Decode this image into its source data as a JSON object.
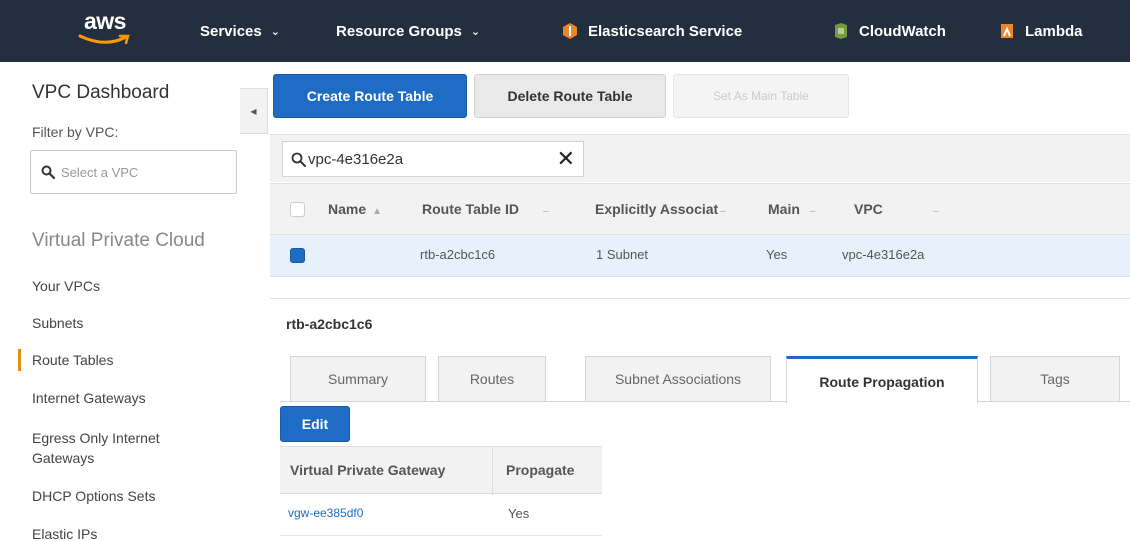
{
  "topnav": {
    "logo_text": "aws",
    "services": "Services",
    "resource_groups": "Resource Groups",
    "shortcuts": [
      {
        "label": "Elasticsearch Service",
        "icon": "elasticsearch-icon",
        "color": "#e7862b"
      },
      {
        "label": "CloudWatch",
        "icon": "cloudwatch-icon",
        "color": "#759c3e"
      },
      {
        "label": "Lambda",
        "icon": "lambda-icon",
        "color": "#e7862b"
      }
    ]
  },
  "sidebar": {
    "title": "VPC Dashboard",
    "filter_label": "Filter by VPC:",
    "vpc_select_placeholder": "Select a VPC",
    "section": "Virtual Private Cloud",
    "items": [
      {
        "label": "Your VPCs"
      },
      {
        "label": "Subnets"
      },
      {
        "label": "Route Tables",
        "active": true
      },
      {
        "label": "Internet Gateways"
      },
      {
        "label": "Egress Only Internet Gateways"
      },
      {
        "label": "DHCP Options Sets"
      },
      {
        "label": "Elastic IPs"
      }
    ]
  },
  "toolbar": {
    "create": "Create Route Table",
    "delete": "Delete Route Table",
    "set_main": "Set As Main Table"
  },
  "search": {
    "value": "vpc-4e316e2a",
    "clear": "✕"
  },
  "table": {
    "columns": [
      "Name",
      "Route Table ID",
      "Explicitly Associat",
      "Main",
      "VPC"
    ],
    "rows": [
      {
        "name": "",
        "route_table_id": "rtb-a2cbc1c6",
        "explicitly_associated": "1 Subnet",
        "main": "Yes",
        "vpc": "vpc-4e316e2a",
        "selected": true
      }
    ]
  },
  "details": {
    "title": "rtb-a2cbc1c6",
    "tabs": [
      "Summary",
      "Routes",
      "Subnet Associations",
      "Route Propagation",
      "Tags"
    ],
    "active_tab": "Route Propagation",
    "edit_label": "Edit",
    "propagation": {
      "columns": [
        "Virtual Private Gateway",
        "Propagate"
      ],
      "rows": [
        {
          "gateway": "vgw-ee385df0",
          "propagate": "Yes"
        }
      ]
    }
  },
  "colors": {
    "nav_bg": "#232f3e",
    "primary": "#1f6cc4",
    "active_indicator": "#e98a15",
    "selected_row": "#e6f1fc"
  }
}
